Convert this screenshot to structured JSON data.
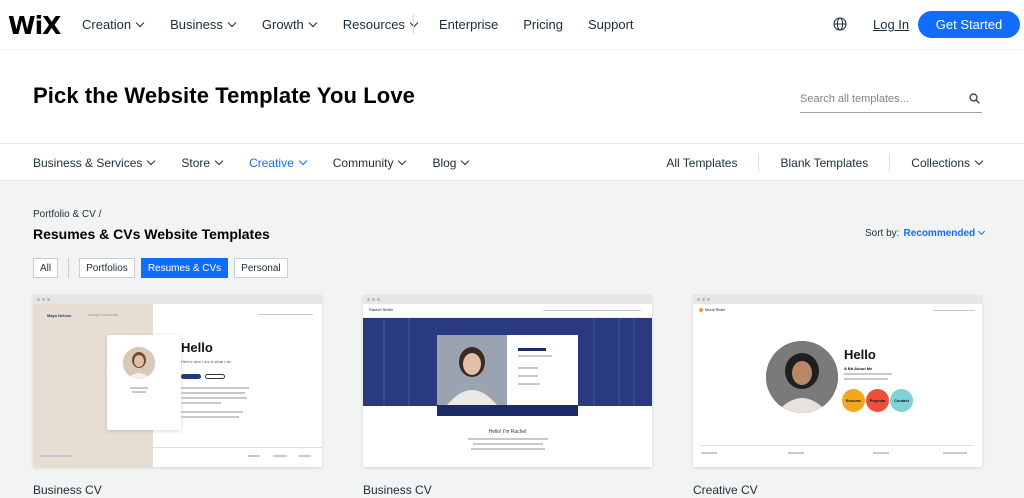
{
  "brand": {
    "logo": "WiX",
    "accent": "#116dff"
  },
  "nav": {
    "primary": [
      {
        "label": "Creation"
      },
      {
        "label": "Business"
      },
      {
        "label": "Growth"
      },
      {
        "label": "Resources"
      }
    ],
    "secondary": [
      "Enterprise",
      "Pricing",
      "Support"
    ],
    "login": "Log In",
    "cta": "Get Started"
  },
  "header": {
    "title": "Pick the Website Template You Love",
    "search_placeholder": "Search all templates..."
  },
  "categories": {
    "left": [
      {
        "label": "Business & Services",
        "active": false
      },
      {
        "label": "Store",
        "active": false
      },
      {
        "label": "Creative",
        "active": true
      },
      {
        "label": "Community",
        "active": false
      },
      {
        "label": "Blog",
        "active": false
      }
    ],
    "right": [
      "All Templates",
      "Blank Templates",
      "Collections"
    ]
  },
  "content": {
    "breadcrumb": "Portfolio & CV /",
    "title": "Resumes & CVs Website Templates",
    "sort_label": "Sort by:",
    "sort_value": "Recommended",
    "filters": [
      "All",
      "Portfolios",
      "Resumes & CVs",
      "Personal"
    ],
    "selected_filter": "Resumes & CVs"
  },
  "templates": [
    {
      "label": "Business CV",
      "preview": {
        "name": "Maya Nelson",
        "heading": "Hello",
        "tagline": "Here's who I am & what I do",
        "role": "PROJECT MANAGER"
      }
    },
    {
      "label": "Business CV",
      "preview": {
        "name": "Rachel Smith",
        "heading": "Hello! I'm Rachel"
      }
    },
    {
      "label": "Creative CV",
      "preview": {
        "name": "Mouli Rider",
        "heading": "Hello",
        "sub": "A Bit About Me",
        "bubbles": [
          "Resume",
          "Projects",
          "Contact"
        ]
      }
    }
  ]
}
